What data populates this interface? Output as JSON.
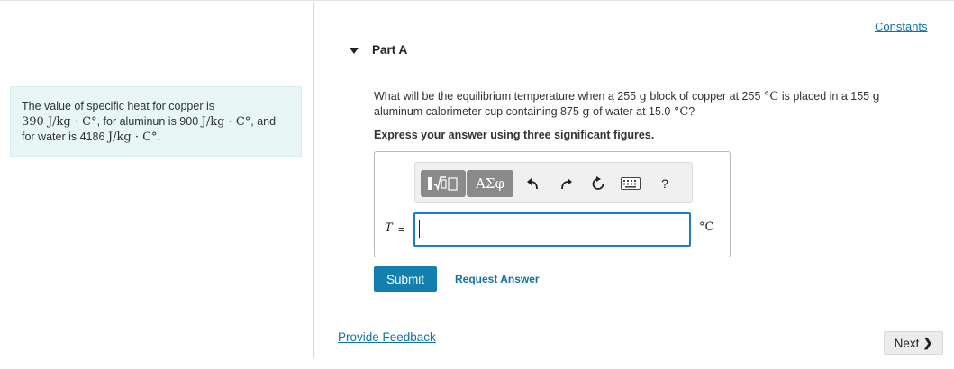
{
  "sidebar_hint": {
    "line1": "The value of specific heat for copper is",
    "line2_value1": "390 J/kg · C°",
    "line2_text": ", for aluminun is 900 ",
    "line2_value2": "J/kg · C°",
    "line2_end": ", and",
    "line3_text": "for water is 4186 ",
    "line3_value": "J/kg · C°",
    "line3_end": "."
  },
  "header": {
    "constants_link": "Constants",
    "part_title": "Part A"
  },
  "question": {
    "line1_a": "What will be the equilibrium temperature when a 255 ",
    "line1_unit1": "g",
    "line1_b": " block of copper at 255 ",
    "line1_unit2": "°C",
    "line1_c": " is placed in a 155 ",
    "line1_unit3": "g",
    "line2_a": "aluminum calorimeter cup containing 875 ",
    "line2_unit1": "g",
    "line2_b": " of water at 15.0 ",
    "line2_unit2": "°C",
    "line2_c": "?",
    "instruction": "Express your answer using three significant figures."
  },
  "answer": {
    "toolbar": {
      "templates_icon": "templates-icon",
      "greek_label": "ΑΣφ",
      "undo_icon": "undo-icon",
      "redo_icon": "redo-icon",
      "reset_icon": "reset-icon",
      "keyboard_icon": "keyboard-icon",
      "help_label": "?"
    },
    "variable": "T",
    "equals": "=",
    "value": "",
    "unit": "°C"
  },
  "actions": {
    "submit_label": "Submit",
    "request_answer_label": "Request Answer",
    "feedback_label": "Provide Feedback",
    "next_label": "Next"
  },
  "colors": {
    "accent": "#127faf",
    "link": "#0f73a6",
    "hint_background": "#e8f6f6"
  }
}
